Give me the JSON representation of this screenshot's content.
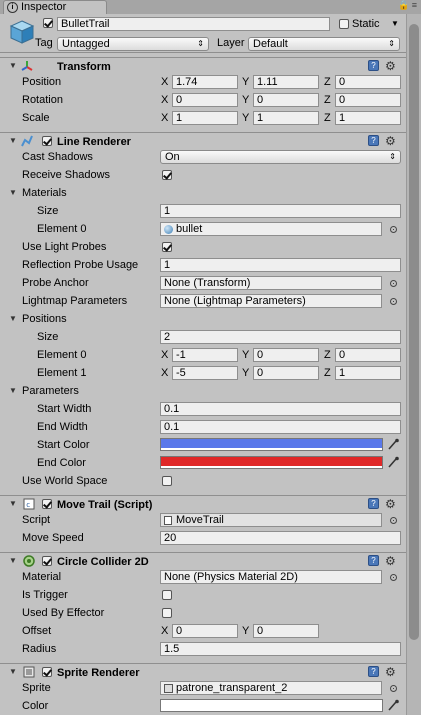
{
  "tab": {
    "title": "Inspector"
  },
  "object": {
    "name": "BulletTrail",
    "static_label": "Static",
    "static_checked": false,
    "tag_label": "Tag",
    "tag_value": "Untagged",
    "layer_label": "Layer",
    "layer_value": "Default"
  },
  "transform": {
    "title": "Transform",
    "position_label": "Position",
    "position": {
      "x": "1.74",
      "y": "1.11",
      "z": "0"
    },
    "rotation_label": "Rotation",
    "rotation": {
      "x": "0",
      "y": "0",
      "z": "0"
    },
    "scale_label": "Scale",
    "scale": {
      "x": "1",
      "y": "1",
      "z": "1"
    }
  },
  "axis": {
    "x": "X",
    "y": "Y",
    "z": "Z"
  },
  "line_renderer": {
    "title": "Line Renderer",
    "cast_shadows_label": "Cast Shadows",
    "cast_shadows": "On",
    "receive_shadows_label": "Receive Shadows",
    "materials_label": "Materials",
    "size_label": "Size",
    "materials_size": "1",
    "element0_label": "Element 0",
    "element0": "bullet",
    "use_light_probes_label": "Use Light Probes",
    "reflection_label": "Reflection Probe Usage",
    "reflection": "1",
    "probe_anchor_label": "Probe Anchor",
    "probe_anchor": "None (Transform)",
    "lightmap_label": "Lightmap Parameters",
    "lightmap": "None (Lightmap Parameters)",
    "positions_label": "Positions",
    "positions_size": "2",
    "pos_el0_label": "Element 0",
    "pos_el0": {
      "x": "-1",
      "y": "0",
      "z": "0"
    },
    "pos_el1_label": "Element 1",
    "pos_el1": {
      "x": "-5",
      "y": "0",
      "z": "1"
    },
    "parameters_label": "Parameters",
    "start_width_label": "Start Width",
    "start_width": "0.1",
    "end_width_label": "End Width",
    "end_width": "0.1",
    "start_color_label": "Start Color",
    "start_color": "#5a78ea",
    "end_color_label": "End Color",
    "end_color": "#e02828",
    "world_space_label": "Use World Space"
  },
  "move_trail": {
    "title": "Move Trail (Script)",
    "script_label": "Script",
    "script": "MoveTrail",
    "move_speed_label": "Move Speed",
    "move_speed": "20"
  },
  "circle_collider": {
    "title": "Circle Collider 2D",
    "material_label": "Material",
    "material": "None (Physics Material 2D)",
    "is_trigger_label": "Is Trigger",
    "used_by_effector_label": "Used By Effector",
    "offset_label": "Offset",
    "offset": {
      "x": "0",
      "y": "0"
    },
    "radius_label": "Radius",
    "radius": "1.5"
  },
  "sprite_renderer": {
    "title": "Sprite Renderer",
    "sprite_label": "Sprite",
    "sprite": "patrone_transparent_2",
    "color_label": "Color",
    "color": "#ffffff"
  }
}
